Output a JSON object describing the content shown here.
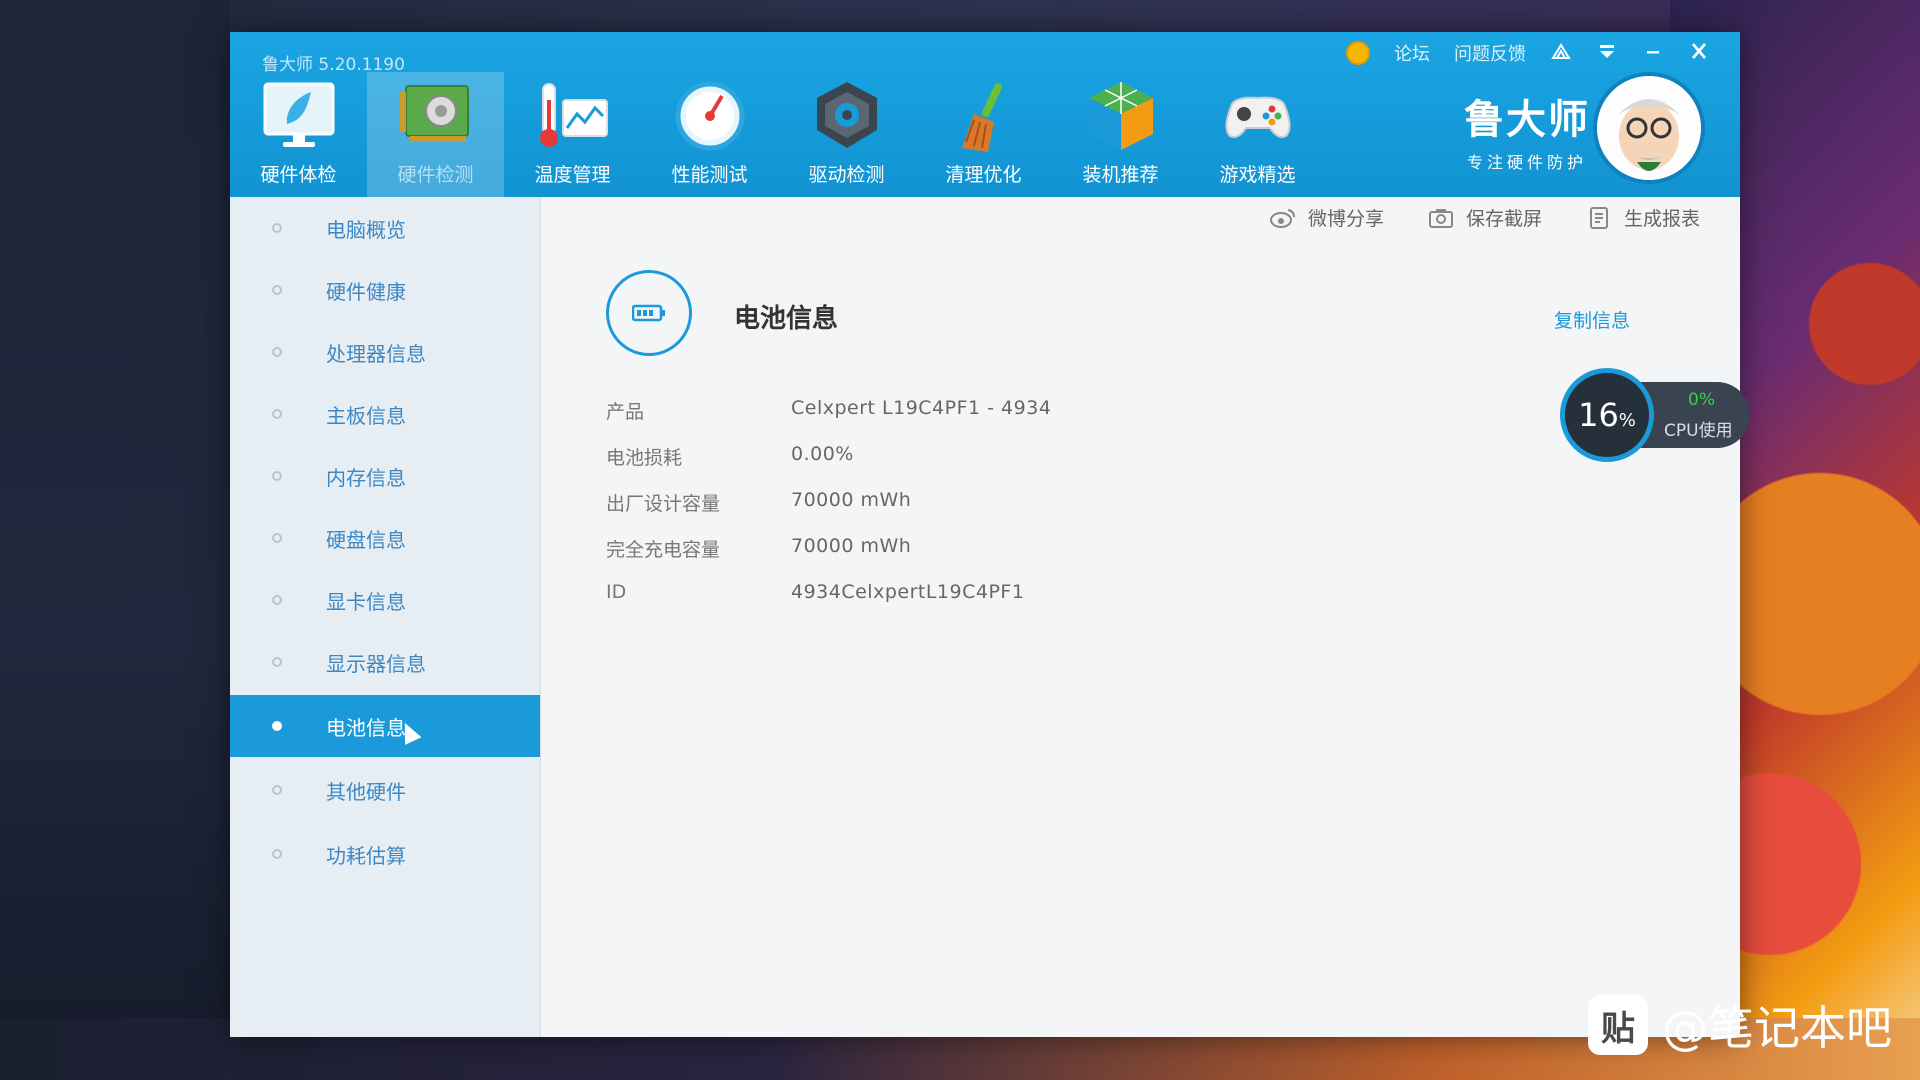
{
  "app": {
    "version": "鲁大师 5.20.1190",
    "top_links": {
      "forum": "论坛",
      "feedback": "问题反馈"
    },
    "window_controls": [
      "skin-icon",
      "menu-icon",
      "minimize-icon",
      "close-icon"
    ]
  },
  "toolbar": {
    "items": [
      {
        "label": "硬件体检",
        "icon": "monitor-check-icon"
      },
      {
        "label": "硬件检测",
        "icon": "circuit-board-icon",
        "active": true
      },
      {
        "label": "温度管理",
        "icon": "thermometer-icon"
      },
      {
        "label": "性能测试",
        "icon": "speedometer-icon"
      },
      {
        "label": "驱动检测",
        "icon": "driver-gear-icon"
      },
      {
        "label": "清理优化",
        "icon": "broom-icon"
      },
      {
        "label": "装机推荐",
        "icon": "cube-icon"
      },
      {
        "label": "游戏精选",
        "icon": "gamepad-icon"
      }
    ]
  },
  "brand": {
    "name": "鲁大师",
    "slogan": "专注硬件防护"
  },
  "sidebar": {
    "items": [
      {
        "label": "电脑概览"
      },
      {
        "label": "硬件健康"
      },
      {
        "label": "处理器信息"
      },
      {
        "label": "主板信息"
      },
      {
        "label": "内存信息"
      },
      {
        "label": "硬盘信息"
      },
      {
        "label": "显卡信息"
      },
      {
        "label": "显示器信息"
      },
      {
        "label": "电池信息",
        "active": true
      },
      {
        "label": "其他硬件"
      },
      {
        "label": "功耗估算"
      }
    ]
  },
  "actions": {
    "weibo_share": "微博分享",
    "save_screenshot": "保存截屏",
    "generate_report": "生成报表"
  },
  "battery": {
    "title": "电池信息",
    "copy_label": "复制信息",
    "rows": [
      {
        "key": "产品",
        "value": "Celxpert L19C4PF1 -  4934"
      },
      {
        "key": "电池损耗",
        "value": "0.00%"
      },
      {
        "key": "出厂设计容量",
        "value": "70000 mWh"
      },
      {
        "key": "完全充电容量",
        "value": "70000 mWh"
      },
      {
        "key": "ID",
        "value": " 4934CelxpertL19C4PF1"
      }
    ]
  },
  "cpu_widget": {
    "value": "16",
    "unit": "%",
    "cpu_percent": "0%",
    "label": "CPU使用"
  },
  "watermark": {
    "logo": "贴",
    "text": "@笔记本吧"
  },
  "colors": {
    "accent": "#1a9ad8",
    "title_bar": "#1aa5e3",
    "cpu_green": "#36d04a"
  }
}
